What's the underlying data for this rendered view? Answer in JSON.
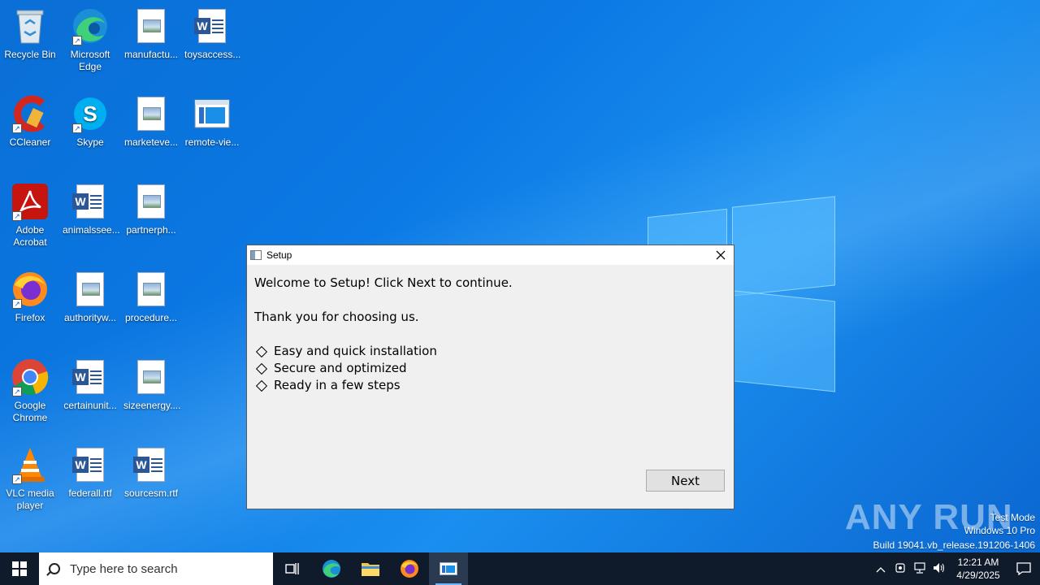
{
  "desktop": {
    "icons": [
      {
        "label": "Recycle Bin",
        "icon": "recycle-bin-icon"
      },
      {
        "label": "Microsoft Edge",
        "icon": "edge-icon"
      },
      {
        "label": "manufactu...",
        "icon": "image-file-icon"
      },
      {
        "label": "toysaccess...",
        "icon": "word-doc-icon"
      },
      {
        "label": "CCleaner",
        "icon": "ccleaner-icon"
      },
      {
        "label": "Skype",
        "icon": "skype-icon"
      },
      {
        "label": "marketeve...",
        "icon": "image-file-icon"
      },
      {
        "label": "remote-vie...",
        "icon": "window-file-icon"
      },
      {
        "label": "Adobe Acrobat",
        "icon": "acrobat-icon"
      },
      {
        "label": "animalssee...",
        "icon": "word-doc-icon"
      },
      {
        "label": "partnerph...",
        "icon": "image-file-icon"
      },
      {
        "label": "Firefox",
        "icon": "firefox-icon"
      },
      {
        "label": "authorityw...",
        "icon": "image-file-icon"
      },
      {
        "label": "procedure...",
        "icon": "image-file-icon"
      },
      {
        "label": "Google Chrome",
        "icon": "chrome-icon"
      },
      {
        "label": "certainunit...",
        "icon": "word-doc-icon"
      },
      {
        "label": "sizeenergy....",
        "icon": "image-file-icon"
      },
      {
        "label": "VLC media player",
        "icon": "vlc-icon"
      },
      {
        "label": "federall.rtf",
        "icon": "word-doc-icon"
      },
      {
        "label": "sourcesm.rtf",
        "icon": "word-doc-icon"
      }
    ]
  },
  "dialog": {
    "title": "Setup",
    "welcome": "Welcome to Setup! Click Next to continue.",
    "thanks": "Thank you for choosing us.",
    "bullets": [
      "Easy and quick installation",
      "Secure and optimized",
      "Ready in a few steps"
    ],
    "next_label": "Next"
  },
  "watermark": {
    "brand": "ANY RUN",
    "mode": "Test Mode",
    "edition": "Windows 10 Pro",
    "build": "Build 19041.vb_release.191206-1406"
  },
  "taskbar": {
    "search_placeholder": "Type here to search",
    "time": "12:21 AM",
    "date": "4/29/2025"
  }
}
